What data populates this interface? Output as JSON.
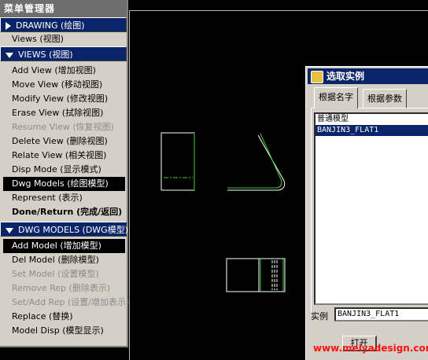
{
  "menu": {
    "title": "菜单管理器",
    "drawing_header": "DRAWING (绘图)",
    "views_item": "Views (视图)",
    "views_header": "VIEWS (视图)",
    "views_items": [
      {
        "label": "Add View (增加视图)",
        "state": "normal"
      },
      {
        "label": "Move View (移动视图)",
        "state": "normal"
      },
      {
        "label": "Modify View (修改视图)",
        "state": "normal"
      },
      {
        "label": "Erase View (拭除视图)",
        "state": "normal"
      },
      {
        "label": "Resume View (恢复视图)",
        "state": "disabled"
      },
      {
        "label": "Delete View (删除视图)",
        "state": "normal"
      },
      {
        "label": "Relate View (相关视图)",
        "state": "normal"
      },
      {
        "label": "Disp Mode (显示模式)",
        "state": "normal"
      },
      {
        "label": "Dwg Models (绘图模型)",
        "state": "selected"
      },
      {
        "label": "Represent (表示)",
        "state": "normal"
      },
      {
        "label": "Done/Return (完成/返回)",
        "state": "bold"
      }
    ],
    "models_header": "DWG MODELS (DWG模型)",
    "models_items": [
      {
        "label": "Add Model (增加模型)",
        "state": "selected"
      },
      {
        "label": "Del Model (删除模型)",
        "state": "normal"
      },
      {
        "label": "Set Model (设置模型)",
        "state": "disabled"
      },
      {
        "label": "Remove Rep (删除表示)",
        "state": "disabled"
      },
      {
        "label": "Set/Add Rep (设置/增加表示)",
        "state": "disabled"
      },
      {
        "label": "Replace (替换)",
        "state": "normal"
      },
      {
        "label": "Model Disp (模型显示)",
        "state": "normal"
      }
    ]
  },
  "dialog": {
    "title": "选取实例",
    "tab_by_name": "根据名字",
    "tab_by_param": "根据参数",
    "list": [
      "普通模型",
      "BANJIN3_FLAT1"
    ],
    "selected_index": 1,
    "field_label": "实例",
    "field_value": "BANJIN3_FLAT1",
    "open_button": "打开"
  },
  "watermark": "www.meiyadesign.com",
  "colors": {
    "geometry": "#ffffff",
    "highlight": "#3cd23c",
    "selection": "#0a246a"
  }
}
